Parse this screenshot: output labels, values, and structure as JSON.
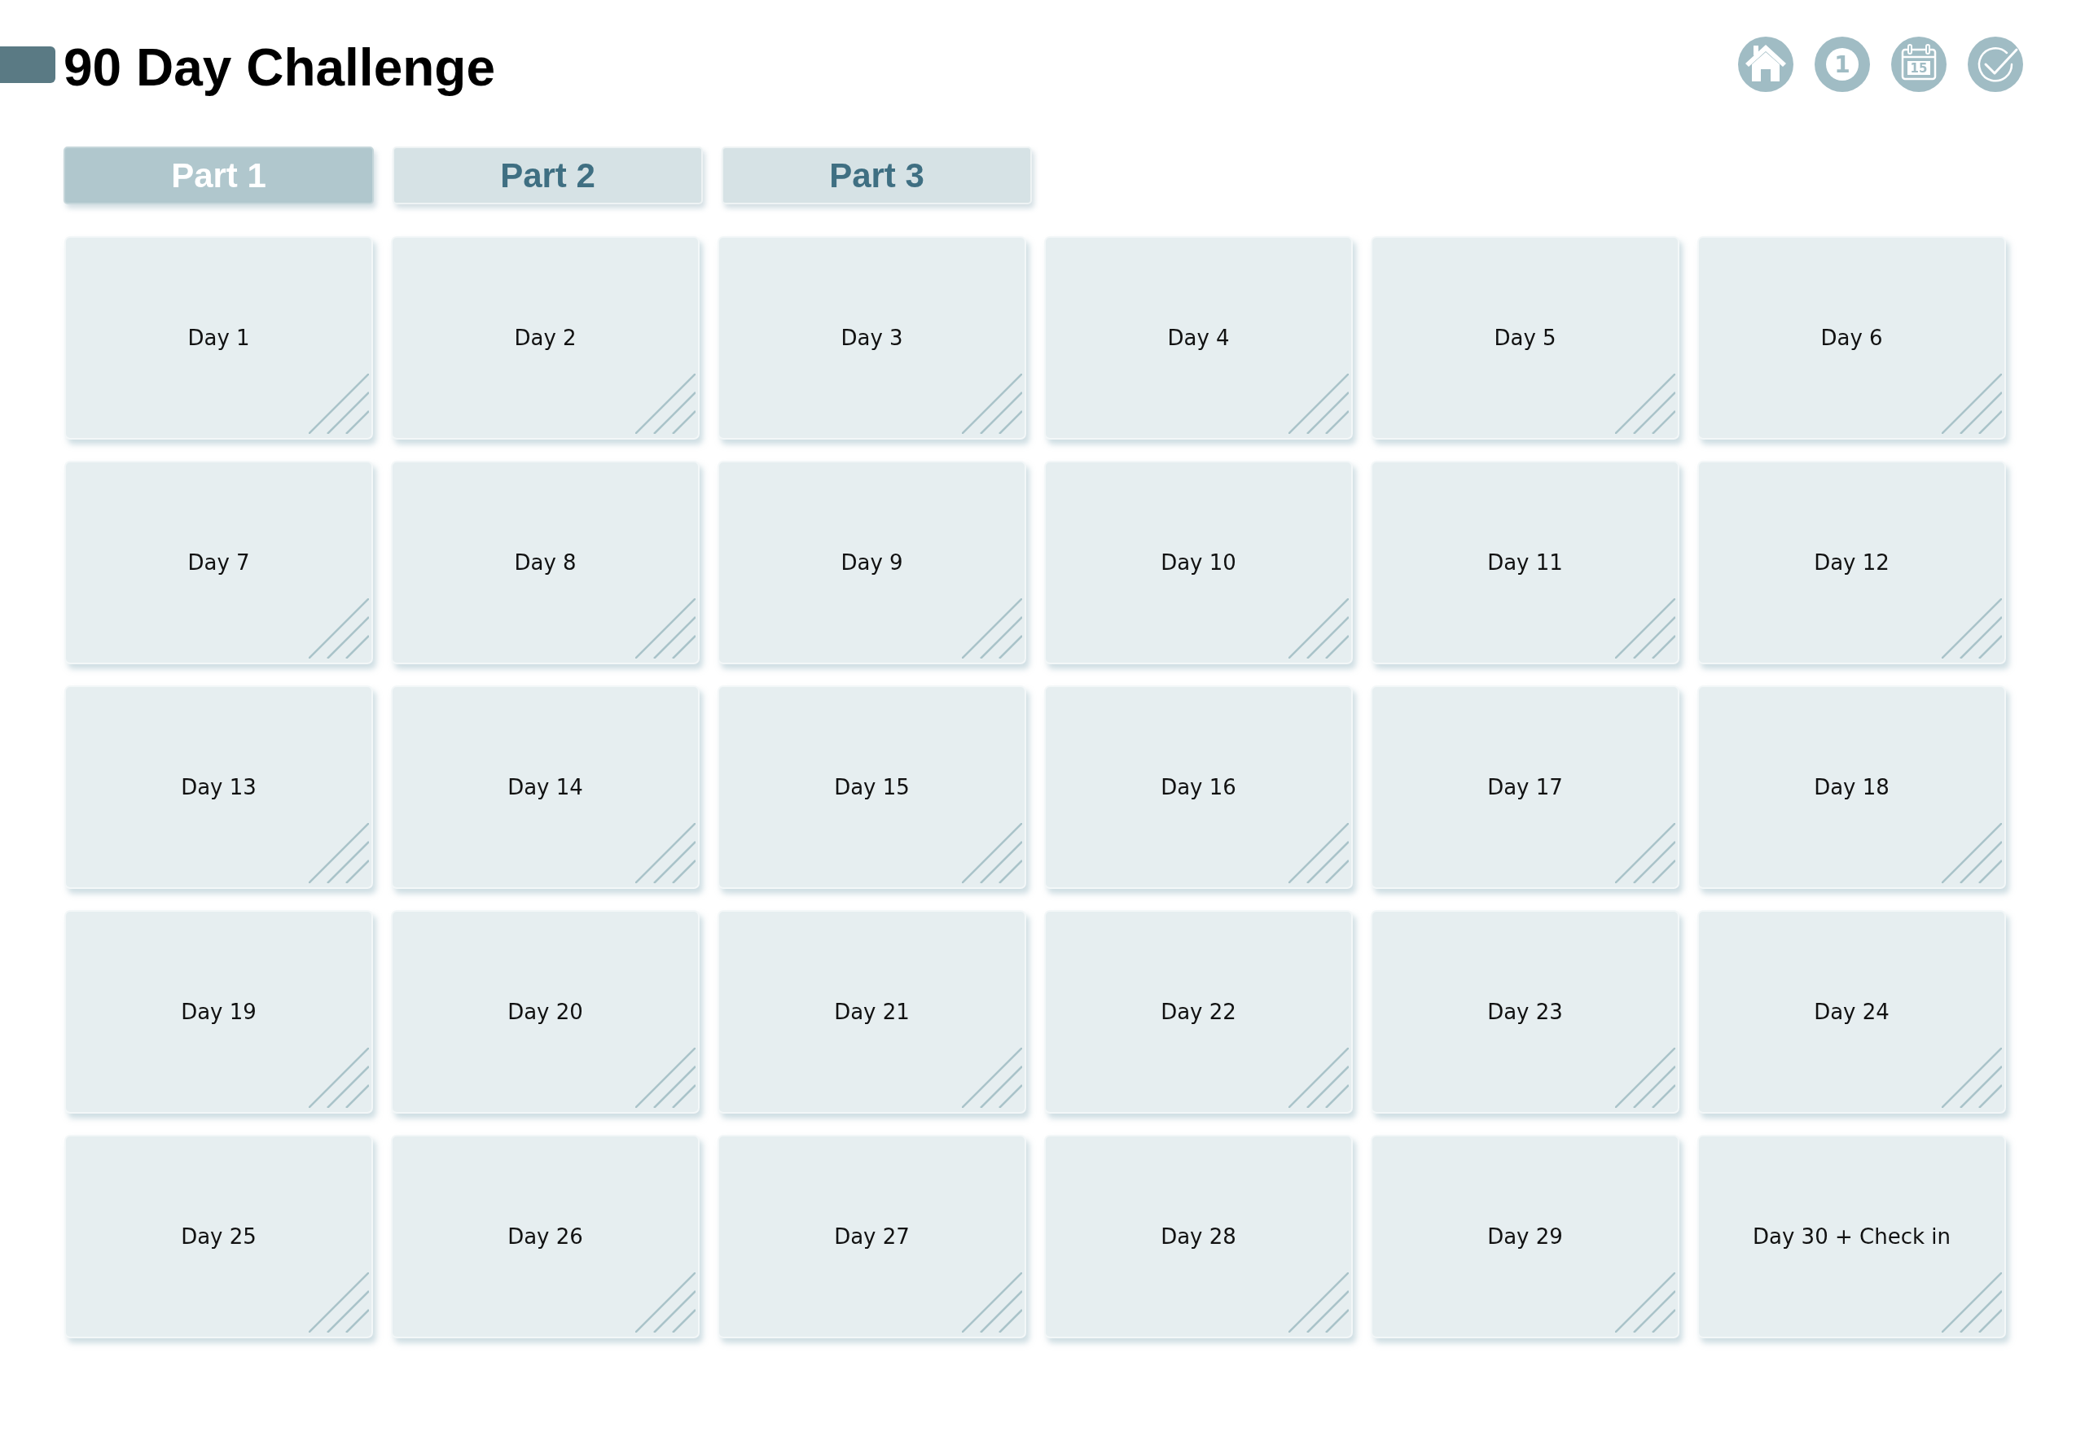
{
  "header": {
    "title": "90 Day Challenge"
  },
  "nav_icons": [
    {
      "kind": "home"
    },
    {
      "kind": "number",
      "text": "1"
    },
    {
      "kind": "calendar",
      "text": "15"
    },
    {
      "kind": "check"
    }
  ],
  "tabs": [
    {
      "label": "Part 1",
      "selected": true
    },
    {
      "label": "Part 2",
      "selected": false
    },
    {
      "label": "Part 3",
      "selected": false
    }
  ],
  "days": [
    "Day 1",
    "Day 2",
    "Day 3",
    "Day 4",
    "Day 5",
    "Day 6",
    "Day 7",
    "Day 8",
    "Day 9",
    "Day 10",
    "Day 11",
    "Day 12",
    "Day 13",
    "Day 14",
    "Day 15",
    "Day 16",
    "Day 17",
    "Day 18",
    "Day 19",
    "Day 20",
    "Day 21",
    "Day 22",
    "Day 23",
    "Day 24",
    "Day 25",
    "Day 26",
    "Day 27",
    "Day 28",
    "Day 29",
    "Day 30 + Check in"
  ]
}
